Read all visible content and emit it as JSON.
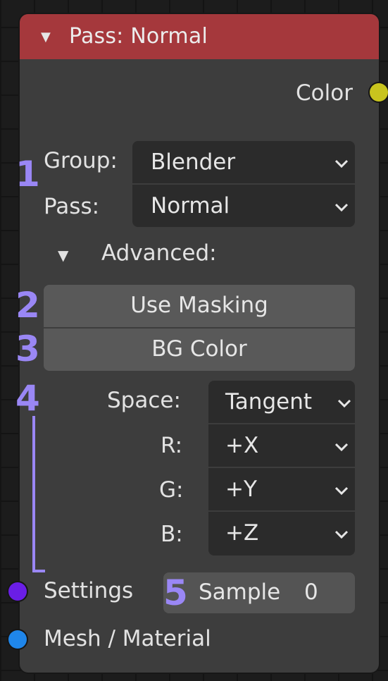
{
  "node": {
    "header": {
      "caret": "▼",
      "title": "Pass: Normal"
    },
    "outputs": [
      {
        "label": "Color",
        "socket_color": "#c8c41e"
      }
    ],
    "group": {
      "label": "Group:",
      "value": "Blender"
    },
    "pass": {
      "label": "Pass:",
      "value": "Normal"
    },
    "advanced": {
      "caret": "▼",
      "label": "Advanced:"
    },
    "use_masking_label": "Use Masking",
    "bg_color_label": "BG Color",
    "space": {
      "label": "Space:",
      "value": "Tangent"
    },
    "r": {
      "label": "R:",
      "value": "+X"
    },
    "g": {
      "label": "G:",
      "value": "+Y"
    },
    "b": {
      "label": "B:",
      "value": "+Z"
    },
    "inputs": [
      {
        "label": "Settings",
        "socket_color": "#6a1ee6"
      },
      {
        "label": "Mesh / Material",
        "socket_color": "#1f86ea"
      }
    ],
    "sample": {
      "label": "Sample",
      "value": "0"
    }
  },
  "annotations": {
    "n1": "1",
    "n2": "2",
    "n3": "3",
    "n4": "4",
    "n5": "5",
    "color": "#9a87f5"
  },
  "colors": {
    "header": "#a5383c",
    "body": "#3d3d3d",
    "dropdown": "#2b2b2b",
    "button": "#595959"
  },
  "icons": {
    "dropdown_chevron": "chevron-down-icon",
    "collapse_caret": "triangle-down-icon"
  }
}
